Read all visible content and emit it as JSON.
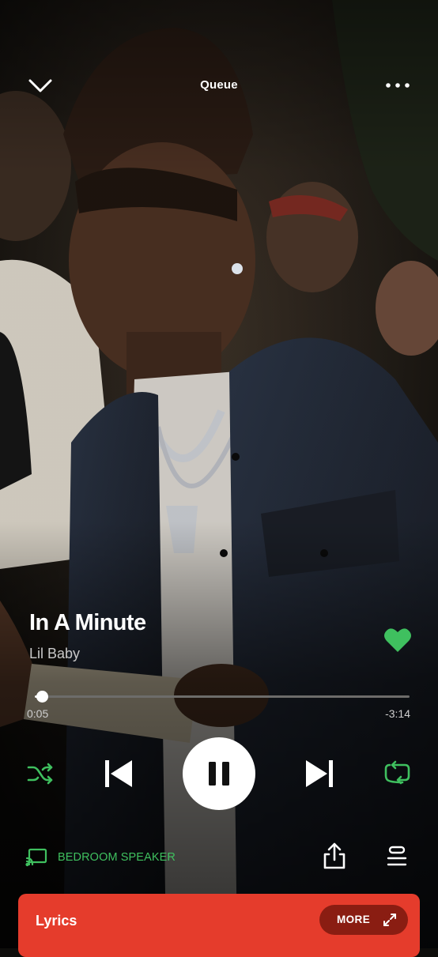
{
  "header": {
    "title": "Queue"
  },
  "track": {
    "title": "In A Minute",
    "artist": "Lil Baby",
    "liked": true
  },
  "progress": {
    "elapsed": "0:05",
    "remaining": "-3:14",
    "fraction": 0.02
  },
  "controls": {
    "shuffle_active": true,
    "repeat_active": true,
    "state": "playing"
  },
  "device": {
    "name": "BEDROOM SPEAKER"
  },
  "lyrics": {
    "label": "Lyrics",
    "more_label": "MORE"
  },
  "colors": {
    "accent_green": "#3fc05f",
    "lyrics_card": "#e53c2c",
    "lyrics_more_bg": "#8a1d12"
  },
  "icons": {
    "close": "chevron-down-icon",
    "menu": "more-horizontal-icon",
    "like": "heart-icon",
    "shuffle": "shuffle-icon",
    "previous": "skip-previous-icon",
    "pause": "pause-icon",
    "next": "skip-next-icon",
    "repeat": "repeat-icon",
    "connect": "cast-device-icon",
    "share": "share-icon",
    "queue": "queue-icon",
    "expand": "expand-icon"
  }
}
